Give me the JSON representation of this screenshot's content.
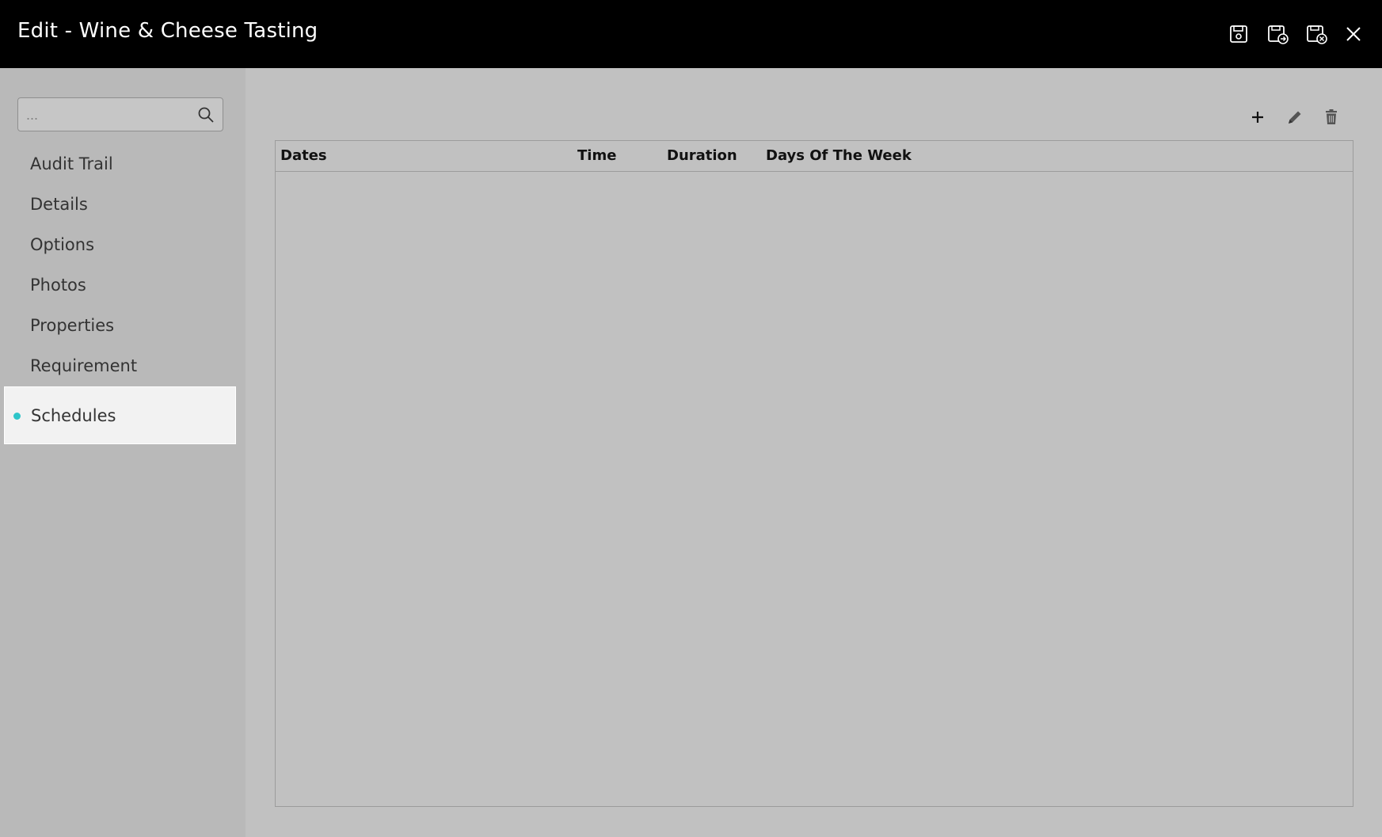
{
  "window": {
    "title": "Edit - Wine & Cheese Tasting",
    "actions": [
      {
        "name": "save",
        "icon": "save-icon"
      },
      {
        "name": "save-and-next",
        "icon": "save-next-icon"
      },
      {
        "name": "save-and-close",
        "icon": "save-close-icon"
      },
      {
        "name": "close",
        "icon": "close-icon"
      }
    ]
  },
  "sidebar": {
    "search": {
      "placeholder": "...",
      "value": ""
    },
    "items": [
      {
        "label": "Audit Trail"
      },
      {
        "label": "Details"
      },
      {
        "label": "Options"
      },
      {
        "label": "Photos"
      },
      {
        "label": "Properties"
      },
      {
        "label": "Requirement"
      },
      {
        "label": "Schedules",
        "active": true
      }
    ]
  },
  "main": {
    "toolbar": [
      {
        "name": "add",
        "icon": "plus-icon"
      },
      {
        "name": "edit",
        "icon": "pencil-icon"
      },
      {
        "name": "delete",
        "icon": "trash-icon"
      }
    ],
    "table": {
      "columns": [
        "Dates",
        "Time",
        "Duration",
        "Days Of The Week"
      ],
      "rows": []
    }
  },
  "colors": {
    "titlebar": "#000000",
    "sidebar": "#b9b9b9",
    "main": "#c1c1c1",
    "active_item": "#f2f2f2",
    "active_dot": "#2ec5c9"
  }
}
